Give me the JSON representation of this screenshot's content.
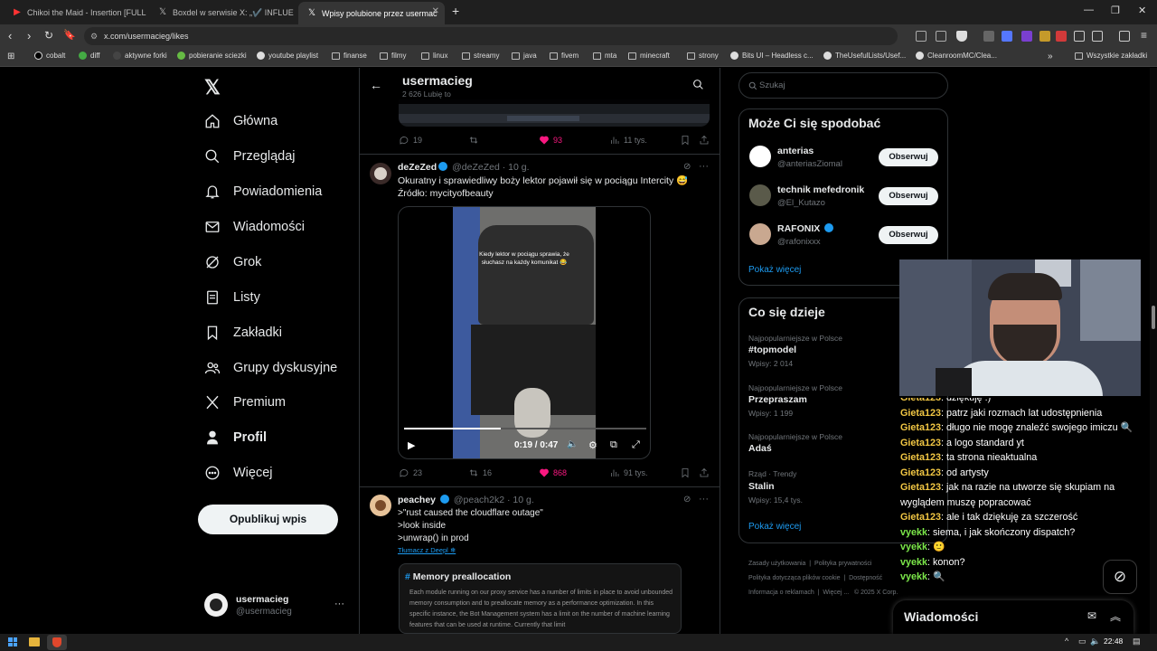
{
  "browser": {
    "tabs": [
      {
        "title": "Chikoi the Maid - Insertion [FULL",
        "icon": "youtube-icon"
      },
      {
        "title": "Boxdel w serwisie X: „✔️ INFLUEN",
        "icon": "x-logo-icon"
      },
      {
        "title": "Wpisy polubione przez usermac",
        "icon": "x-logo-icon"
      }
    ],
    "url": "x.com/usermacieg/likes",
    "bookmarks": [
      "cobalt",
      "diff",
      "aktywne forki",
      "pobieranie sciezki",
      "youtube playlist",
      "finanse",
      "linux",
      "streamy",
      "java",
      "fivem",
      "mta",
      "minecraft",
      "strony",
      "Bits UI – Headless c...",
      "TheUsefulLists/Usef...",
      "CleanroomMC/Clea..."
    ],
    "bookmarks_other": "Wszystkie zakładki"
  },
  "sidebar": {
    "items": [
      {
        "label": "Główna",
        "icon": "home-icon"
      },
      {
        "label": "Przeglądaj",
        "icon": "search-icon"
      },
      {
        "label": "Powiadomienia",
        "icon": "bell-icon"
      },
      {
        "label": "Wiadomości",
        "icon": "mail-icon"
      },
      {
        "label": "Grok",
        "icon": "grok-icon"
      },
      {
        "label": "Listy",
        "icon": "list-icon"
      },
      {
        "label": "Zakładki",
        "icon": "bookmark-icon"
      },
      {
        "label": "Grupy dyskusyjne",
        "icon": "people-icon"
      },
      {
        "label": "Premium",
        "icon": "x-logo-icon"
      },
      {
        "label": "Profil",
        "icon": "person-icon"
      },
      {
        "label": "Więcej",
        "icon": "more-circle-icon"
      }
    ],
    "post_button": "Opublikuj wpis",
    "account": {
      "name": "usermacieg",
      "handle": "@usermacieg"
    }
  },
  "header": {
    "title": "usermacieg",
    "subtitle": "2 626 Lubię to"
  },
  "prev_post": {
    "replies": "19",
    "reposts": "",
    "likes": "93",
    "views": "11 tys."
  },
  "post1": {
    "author": "deZeZed",
    "handle": "@deZeZed",
    "time": "· 10 g.",
    "text1": "Okuratny i sprawiedliwy boży lektor pojawił się w pociągu Intercity 😅",
    "text2": "Źródło: mycityofbeauty",
    "video_caption": "Kiedy lektor w pociągu sprawia, że słuchasz na każdy komunikat 😂",
    "video_time": "0:19 / 0:47",
    "progress": 0.4,
    "replies": "23",
    "reposts": "16",
    "likes": "868",
    "views": "91 tys."
  },
  "post2": {
    "author": "peachey",
    "handle": "@peach2k2",
    "time": "· 10 g.",
    "line1": ">\"rust caused the cloudflare outage\"",
    "line2": ">look inside",
    "line3": ">unwrap() in prod",
    "translate": "Tłumacz z Deepl",
    "embed_title": "Memory preallocation",
    "embed_text": "Each module running on our proxy service has a number of limits in place to avoid unbounded memory consumption and to preallocate memory as a performance optimization. In this specific instance, the Bot Management system has a limit on the number of machine learning features that can be used at runtime. Currently that limit"
  },
  "right": {
    "search_placeholder": "Szukaj",
    "who_title": "Może Ci się spodobać",
    "who": [
      {
        "name": "anterias",
        "handle": "@anteriasZiomal",
        "button": "Obserwuj"
      },
      {
        "name": "technik mefedronik",
        "handle": "@El_Kutazo",
        "button": "Obserwuj"
      },
      {
        "name": "RAFONIX",
        "handle": "@rafonixxx",
        "button": "Obserwuj"
      }
    ],
    "show_more": "Pokaż więcej",
    "trends_title": "Co się dzieje",
    "trends": [
      {
        "context": "Najpopularniejsze w Polsce",
        "name": "#topmodel",
        "count": "Wpisy: 2 014"
      },
      {
        "context": "Najpopularniejsze w Polsce",
        "name": "Przepraszam",
        "count": "Wpisy: 1 199"
      },
      {
        "context": "Najpopularniejsze w Polsce",
        "name": "Adaś",
        "count": ""
      },
      {
        "context": "Rząd · Trendy",
        "name": "Stalin",
        "count": "Wpisy: 15,4 tys."
      }
    ],
    "trends_more": "Pokaż więcej",
    "footer": [
      "Zasady użytkowania",
      "Polityka prywatności",
      "Polityka dotycząca plików cookie",
      "Dostępność",
      "Informacja o reklamach",
      "Więcej ...",
      "© 2025 X Corp."
    ]
  },
  "chat": [
    {
      "user": "Gieta123",
      "msg": "dziękuję :)"
    },
    {
      "user": "Gieta123",
      "msg": "patrz jaki rozmach lat udostępnienia"
    },
    {
      "user": "Gieta123",
      "msg": "długo nie mogę znaleźć swojego imiczu 🔍"
    },
    {
      "user": "Gieta123",
      "msg": "a logo standard yt"
    },
    {
      "user": "Gieta123",
      "msg": "ta strona nieaktualna"
    },
    {
      "user": "Gieta123",
      "msg": "od artysty"
    },
    {
      "user": "Gieta123",
      "msg": "jak na razie na utworze się skupiam na"
    },
    {
      "user": "",
      "msg": "wyglądem muszę popracować"
    },
    {
      "user": "Gieta123",
      "msg": "ale i tak dziękuję za szczerość"
    },
    {
      "user": "vyekk",
      "msg": "siema, i jak skończony dispatch?"
    },
    {
      "user": "vyekk",
      "msg": "🙂"
    },
    {
      "user": "vyekk",
      "msg": "konon?"
    },
    {
      "user": "vyekk",
      "msg": "🔍"
    }
  ],
  "messages_panel": "Wiadomości",
  "taskbar": {
    "time": "22:48"
  }
}
